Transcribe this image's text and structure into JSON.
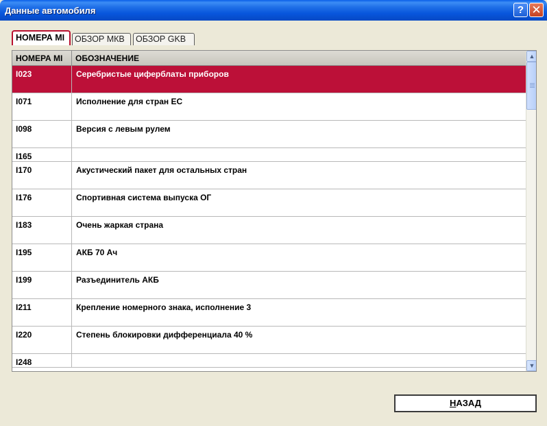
{
  "window": {
    "title": "Данные автомобиля",
    "help_glyph": "?",
    "close_glyph": "✕"
  },
  "tabs": [
    {
      "label": "НОМЕРА MI",
      "active": true
    },
    {
      "label": "ОБЗОР МКВ",
      "active": false
    },
    {
      "label": "ОБЗОР GKB",
      "active": false
    }
  ],
  "table": {
    "columns": [
      "НОМЕРА MI",
      "ОБОЗНАЧЕНИЕ"
    ],
    "rows": [
      {
        "code": "I023",
        "desc": "Серебристые циферблаты приборов",
        "selected": true
      },
      {
        "code": "I071",
        "desc": "Исполнение для стран ЕС"
      },
      {
        "code": "I098",
        "desc": "Версия с левым рулем"
      },
      {
        "code": "I165",
        "desc": ""
      },
      {
        "code": "I170",
        "desc": "Акустический пакет для остальных стран"
      },
      {
        "code": "I176",
        "desc": "Спортивная система выпуска ОГ"
      },
      {
        "code": "I183",
        "desc": "Очень жаркая страна"
      },
      {
        "code": "I195",
        "desc": "АКБ 70 Ач"
      },
      {
        "code": "I199",
        "desc": "Разъединитель АКБ"
      },
      {
        "code": "I211",
        "desc": "Крепление номерного знака, исполнение 3"
      },
      {
        "code": "I220",
        "desc": "Степень блокировки дифференциала 40 %"
      },
      {
        "code": "I248",
        "desc": ""
      }
    ]
  },
  "buttons": {
    "back_first": "Н",
    "back_rest": "АЗАД"
  },
  "colors": {
    "selection": "#bc1038",
    "title_bar": "#0856dc",
    "active_tab_border": "#b8102f"
  }
}
